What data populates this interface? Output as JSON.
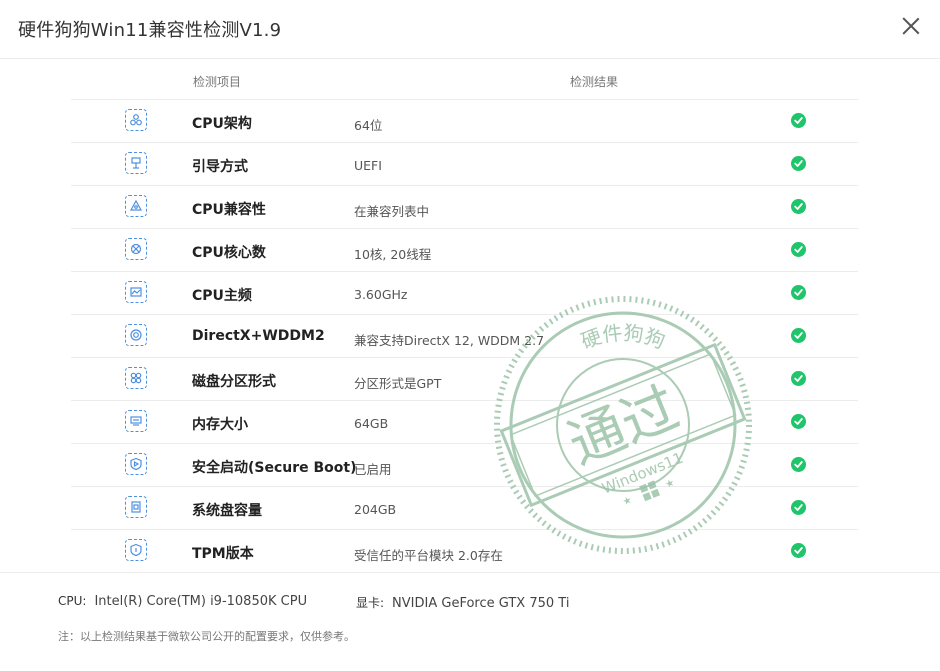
{
  "window": {
    "title": "硬件狗狗Win11兼容性检测V1.9",
    "close_icon": "close-icon"
  },
  "table": {
    "header_item": "检测项目",
    "header_result": "检测结果",
    "rows": [
      {
        "icon": "cpu-arch-icon",
        "name": "CPU架构",
        "value": "64位",
        "status": "pass"
      },
      {
        "icon": "boot-mode-icon",
        "name": "引导方式",
        "value": "UEFI",
        "status": "pass"
      },
      {
        "icon": "cpu-compat-icon",
        "name": "CPU兼容性",
        "value": "在兼容列表中",
        "status": "pass"
      },
      {
        "icon": "cpu-cores-icon",
        "name": "CPU核心数",
        "value": "10核, 20线程",
        "status": "pass"
      },
      {
        "icon": "cpu-freq-icon",
        "name": "CPU主频",
        "value": "3.60GHz",
        "status": "pass"
      },
      {
        "icon": "directx-icon",
        "name": "DirectX+WDDM2",
        "value": "兼容支持DirectX 12, WDDM 2.7",
        "status": "pass"
      },
      {
        "icon": "partition-icon",
        "name": "磁盘分区形式",
        "value": "分区形式是GPT",
        "status": "pass"
      },
      {
        "icon": "memory-icon",
        "name": "内存大小",
        "value": "64GB",
        "status": "pass"
      },
      {
        "icon": "secure-boot-icon",
        "name": "安全启动(Secure Boot)",
        "value": "已启用",
        "status": "pass"
      },
      {
        "icon": "disk-capacity-icon",
        "name": "系统盘容量",
        "value": "204GB",
        "status": "pass"
      },
      {
        "icon": "tpm-icon",
        "name": "TPM版本",
        "value": "受信任的平台模块 2.0存在",
        "status": "pass"
      }
    ]
  },
  "footer": {
    "cpu_label": "CPU:",
    "cpu_value": "Intel(R) Core(TM) i9-10850K CPU",
    "gpu_label": "显卡:",
    "gpu_value": "NVIDIA GeForce GTX 750 Ti",
    "note": "注：以上检测结果基于微软公司公开的配置要求，仅供参考。"
  },
  "stamp": {
    "top_text": "硬件狗狗",
    "main_text": "通过",
    "bottom_text": "Windows11"
  },
  "colors": {
    "accent": "#4d8fe0",
    "pass": "#1ec56a",
    "stamp": "#9cc2a8"
  }
}
